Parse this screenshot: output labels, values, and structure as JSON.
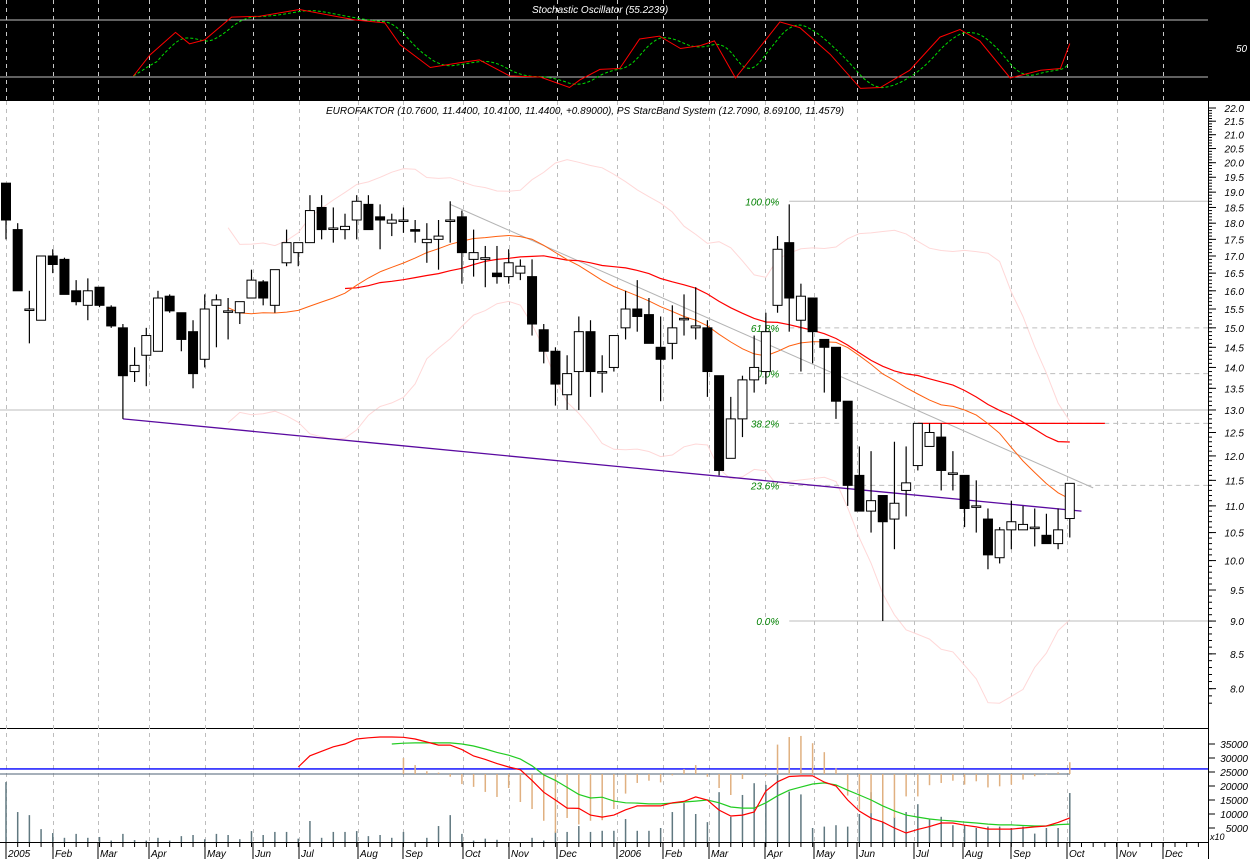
{
  "chart_data": [
    {
      "type": "candlestick",
      "name": "price",
      "title": "EUROFAKTOR (10.7600, 11.4400, 10.4100, 11.4400, +0.89000), PS StarcBand System  (12.7090, 8.69100, 11.4579)",
      "x_unit": "week index (weekly candles, Jan 2005 - Oct 2006)",
      "y_scale": "log",
      "ylim": [
        7.6,
        22.2
      ],
      "y_ticks": [
        "22.0",
        "21.5",
        "21.0",
        "20.5",
        "20.0",
        "19.5",
        "19.0",
        "18.5",
        "18.0",
        "17.5",
        "17.0",
        "16.5",
        "16.0",
        "15.5",
        "15.0",
        "14.5",
        "14.0",
        "13.5",
        "13.0",
        "12.5",
        "12.0",
        "11.5",
        "11.0",
        "10.5",
        "10.0",
        "9.5",
        "9.0",
        "8.5",
        "8.0"
      ],
      "ohlc": [
        [
          19.3,
          19.3,
          17.5,
          18.1
        ],
        [
          17.8,
          18.0,
          16.0,
          16.0
        ],
        [
          15.5,
          16.0,
          14.6,
          15.5
        ],
        [
          15.2,
          17.0,
          15.2,
          17.0
        ],
        [
          17.0,
          17.2,
          16.5,
          16.75
        ],
        [
          16.9,
          16.95,
          15.9,
          15.9
        ],
        [
          16.0,
          16.3,
          15.6,
          15.7
        ],
        [
          15.6,
          16.35,
          15.2,
          16.0
        ],
        [
          16.1,
          16.1,
          15.55,
          15.6
        ],
        [
          15.55,
          15.6,
          15.0,
          15.05
        ],
        [
          15.0,
          15.1,
          12.8,
          13.8
        ],
        [
          13.9,
          14.5,
          13.65,
          14.05
        ],
        [
          14.3,
          15.0,
          13.55,
          14.8
        ],
        [
          14.4,
          16.0,
          14.4,
          15.8
        ],
        [
          15.85,
          15.9,
          15.4,
          15.45
        ],
        [
          15.4,
          15.4,
          14.4,
          14.7
        ],
        [
          14.9,
          15.2,
          13.5,
          13.85
        ],
        [
          14.2,
          15.9,
          14.0,
          15.5
        ],
        [
          15.6,
          15.9,
          14.5,
          15.75
        ],
        [
          15.45,
          15.8,
          14.7,
          15.45
        ],
        [
          15.4,
          15.7,
          15.1,
          15.7
        ],
        [
          15.8,
          16.6,
          15.8,
          16.3
        ],
        [
          16.25,
          16.3,
          15.6,
          15.8
        ],
        [
          15.6,
          16.6,
          15.4,
          16.6
        ],
        [
          16.8,
          17.8,
          16.7,
          17.4
        ],
        [
          17.1,
          17.4,
          16.7,
          17.4
        ],
        [
          17.4,
          18.9,
          17.4,
          18.4
        ],
        [
          18.5,
          18.9,
          17.5,
          17.8
        ],
        [
          17.85,
          18.5,
          17.4,
          17.85
        ],
        [
          17.8,
          18.3,
          17.5,
          17.9
        ],
        [
          18.1,
          18.9,
          17.5,
          18.7
        ],
        [
          18.6,
          18.9,
          17.8,
          17.8
        ],
        [
          18.2,
          18.6,
          17.2,
          18.1
        ],
        [
          18.0,
          18.3,
          17.6,
          18.1
        ],
        [
          18.1,
          18.5,
          17.7,
          18.1
        ],
        [
          17.8,
          18.1,
          17.4,
          17.75
        ],
        [
          17.4,
          18.0,
          16.8,
          17.5
        ],
        [
          17.5,
          18.1,
          16.6,
          17.6
        ],
        [
          18.1,
          18.7,
          17.4,
          18.1
        ],
        [
          18.2,
          18.4,
          16.2,
          17.1
        ],
        [
          16.9,
          17.8,
          16.4,
          17.1
        ],
        [
          16.9,
          17.3,
          16.1,
          16.95
        ],
        [
          16.5,
          17.3,
          16.2,
          16.4
        ],
        [
          16.4,
          17.2,
          16.2,
          16.8
        ],
        [
          16.5,
          16.9,
          16.3,
          16.7
        ],
        [
          16.4,
          16.9,
          14.8,
          15.1
        ],
        [
          14.95,
          15.1,
          14.1,
          14.4
        ],
        [
          14.4,
          14.5,
          13.1,
          13.6
        ],
        [
          13.35,
          14.3,
          13.0,
          13.85
        ],
        [
          13.9,
          15.3,
          13.0,
          14.9
        ],
        [
          14.9,
          15.2,
          13.3,
          13.9
        ],
        [
          13.9,
          14.3,
          13.4,
          13.9
        ],
        [
          14.0,
          14.8,
          13.9,
          14.8
        ],
        [
          15.0,
          16.0,
          14.7,
          15.5
        ],
        [
          15.5,
          16.3,
          14.9,
          15.3
        ],
        [
          15.35,
          15.8,
          14.6,
          14.6
        ],
        [
          14.5,
          15.3,
          13.2,
          14.2
        ],
        [
          14.6,
          15.6,
          14.2,
          15.0
        ],
        [
          15.25,
          15.9,
          14.8,
          15.25
        ],
        [
          15.0,
          16.1,
          14.7,
          15.05
        ],
        [
          15.0,
          15.2,
          13.3,
          13.9
        ],
        [
          13.8,
          13.8,
          11.6,
          11.7
        ],
        [
          11.95,
          13.3,
          11.95,
          12.8
        ],
        [
          12.8,
          13.8,
          12.4,
          13.7
        ],
        [
          13.7,
          14.8,
          13.4,
          14.0
        ],
        [
          13.9,
          15.4,
          13.6,
          14.9
        ],
        [
          15.6,
          17.6,
          15.4,
          17.2
        ],
        [
          17.4,
          18.6,
          14.9,
          15.8
        ],
        [
          15.2,
          16.2,
          13.9,
          15.85
        ],
        [
          15.8,
          15.8,
          14.1,
          14.9
        ],
        [
          14.7,
          14.7,
          13.4,
          14.5
        ],
        [
          14.5,
          14.5,
          12.8,
          13.2
        ],
        [
          13.2,
          13.2,
          11.0,
          11.4
        ],
        [
          11.6,
          12.2,
          10.9,
          10.9
        ],
        [
          10.9,
          12.1,
          10.5,
          11.1
        ],
        [
          11.2,
          11.2,
          9.0,
          10.7
        ],
        [
          10.75,
          12.3,
          10.2,
          11.05
        ],
        [
          11.3,
          12.2,
          10.8,
          11.45
        ],
        [
          11.8,
          12.7,
          11.7,
          12.7
        ],
        [
          12.2,
          12.7,
          12.2,
          12.5
        ],
        [
          12.4,
          12.7,
          11.3,
          11.7
        ],
        [
          11.65,
          12.1,
          11.3,
          11.65
        ],
        [
          11.6,
          11.6,
          10.6,
          10.95
        ],
        [
          11.0,
          11.5,
          10.5,
          11.0
        ],
        [
          10.75,
          10.95,
          9.85,
          10.1
        ],
        [
          10.05,
          10.6,
          9.95,
          10.55
        ],
        [
          10.55,
          11.1,
          10.2,
          10.7
        ],
        [
          10.55,
          11.0,
          10.55,
          10.65
        ],
        [
          10.6,
          10.95,
          10.25,
          10.6
        ],
        [
          10.45,
          10.85,
          10.3,
          10.3
        ],
        [
          10.3,
          10.95,
          10.2,
          10.55
        ],
        [
          10.76,
          11.44,
          10.41,
          11.44
        ]
      ],
      "moving_averages": [
        {
          "name": "short MA",
          "period": 20,
          "color": "#ff6010"
        },
        {
          "name": "long MA",
          "period": 30,
          "color": "#ff0000"
        }
      ],
      "band_color": "#ffd8d8",
      "trendlines": [
        {
          "name": "support",
          "from": [
            10,
            12.8
          ],
          "to": [
            92,
            10.9
          ],
          "color": "#5a0aa0"
        },
        {
          "name": "resistance",
          "from": [
            38,
            18.6
          ],
          "to": [
            93,
            11.35
          ],
          "color": "#b4b4b4"
        }
      ],
      "horizontal_lines": [
        {
          "value": 13.0,
          "from": 0,
          "color": "#bdbdbd"
        },
        {
          "value": 12.7,
          "from": 78,
          "to": 94,
          "color": "#ff0000"
        }
      ],
      "fibonacci": {
        "from_week": 67,
        "high": 18.7,
        "low": 9.0,
        "color": "#008000",
        "levels": [
          {
            "label": "100.0%",
            "value": 18.7
          },
          {
            "label": "61.8%",
            "value": 15.0
          },
          {
            "label": "50.0%",
            "value": 13.85
          },
          {
            "label": "38.2%",
            "value": 12.7
          },
          {
            "label": "23.6%",
            "value": 11.4
          },
          {
            "label": "0.0%",
            "value": 9.0
          }
        ]
      }
    },
    {
      "type": "line",
      "name": "stochastic",
      "title": "Stochastic Oscillator (55.2239)",
      "ylim": [
        0,
        100
      ],
      "levels": [
        80,
        20
      ],
      "y_tick": "50",
      "k_points": [
        [
          10.9,
          21
        ],
        [
          12.3,
          43
        ],
        [
          14.5,
          67
        ],
        [
          15.7,
          55
        ],
        [
          17,
          59
        ],
        [
          19.3,
          83
        ],
        [
          21.7,
          84
        ],
        [
          25.1,
          91
        ],
        [
          27.7,
          85
        ],
        [
          29.9,
          80
        ],
        [
          32.4,
          77
        ],
        [
          33.7,
          54
        ],
        [
          36.3,
          30
        ],
        [
          38.8,
          35
        ],
        [
          40.5,
          38
        ],
        [
          43.1,
          21
        ],
        [
          45.7,
          20
        ],
        [
          48.2,
          9
        ],
        [
          49.1,
          17
        ],
        [
          50.8,
          28
        ],
        [
          52.5,
          29
        ],
        [
          54.2,
          60
        ],
        [
          55.9,
          63
        ],
        [
          57.7,
          50
        ],
        [
          59.4,
          53
        ],
        [
          60.6,
          58
        ],
        [
          62.4,
          19
        ],
        [
          66.2,
          78
        ],
        [
          67.9,
          72
        ],
        [
          70.5,
          44
        ],
        [
          73.1,
          8
        ],
        [
          74.8,
          9
        ],
        [
          77.3,
          27
        ],
        [
          79.9,
          62
        ],
        [
          81.6,
          70
        ],
        [
          83.3,
          58
        ],
        [
          85.9,
          19
        ],
        [
          88.5,
          27
        ],
        [
          90.2,
          29
        ],
        [
          91,
          55.2
        ]
      ],
      "k_color": "#ff0000",
      "d_color": "#00dd00"
    },
    {
      "type": "bar",
      "name": "volume",
      "multiplier_label": "x10",
      "y_ticks": [
        "35000",
        "30000",
        "25000",
        "20000",
        "15000",
        "10000",
        "5000"
      ],
      "ylim": [
        0,
        40000
      ],
      "volume_thousands": [
        21.4,
        10.7,
        9.6,
        4.6,
        3.2,
        1.5,
        2.9,
        1.5,
        1.8,
        0.5,
        2.9,
        0.7,
        0.5,
        1.5,
        0.5,
        2.1,
        2.5,
        1,
        2.9,
        2.5,
        1,
        3.9,
        2.5,
        3.6,
        3.6,
        1.2,
        7.5,
        1.5,
        3.6,
        3.6,
        3.9,
        2.1,
        2.5,
        1.5,
        3.6,
        0,
        1.5,
        5.7,
        9.6,
        2.9,
        0.5,
        1.2,
        0.8,
        0,
        0,
        1.5,
        0.5,
        3.8,
        3.6,
        5.7,
        3.6,
        4,
        4,
        8.2,
        4,
        4,
        5,
        10.7,
        13.9,
        10,
        7.1,
        17.8,
        9,
        16.8,
        21,
        20.4,
        23.9,
        18,
        17,
        5,
        5.5,
        6,
        5.5,
        10,
        17.8,
        8,
        9,
        10.7,
        13.5,
        8,
        9,
        6,
        6,
        5,
        5.5,
        5.5,
        5,
        5.5,
        3,
        5,
        5,
        17.5
      ],
      "oscillator_start": 34,
      "oscillator_thousands": [
        5.7,
        3.2,
        1,
        0.5,
        -1,
        -3.6,
        -4.6,
        -6.4,
        -8.2,
        -5,
        -10,
        -12.5,
        -16.7,
        -21,
        -15.7,
        -18,
        -16.7,
        -16.5,
        -12.5,
        -7,
        -3.2,
        -2.4,
        -3,
        -0.5,
        1.8,
        3.2,
        -1,
        -5,
        -7.5,
        -1.8,
        0,
        -0.5,
        10.5,
        13.2,
        13.6,
        11,
        7.8,
        2,
        -7.7,
        -12.7,
        -14,
        -17,
        -15.7,
        -8,
        -8,
        -4,
        -3.2,
        -2.4,
        -3.8,
        -2.6,
        -4.8,
        -4.4,
        -3.8,
        -2,
        -0.8,
        -0.2,
        0.6,
        4.2
      ],
      "red_start": 25,
      "red_line": [
        26.8,
        30.8,
        32.4,
        34.0,
        35.0,
        36.8,
        37.2,
        37.5,
        37.5,
        37.4,
        36.8,
        35.7,
        34.6,
        34.6,
        33.0,
        30.7,
        29.5,
        28.0,
        26.8,
        25.8,
        22.0,
        17.8,
        15.0,
        12.1,
        12.0,
        9.6,
        8.9,
        9.6,
        11.5,
        12.9,
        12.9,
        12.9,
        14.0,
        14.5,
        16.1,
        15.0,
        11.4,
        9.3,
        9.6,
        10.7,
        18.2,
        21.5,
        23.4,
        23.6,
        23.6,
        21.4,
        20.0,
        15.0,
        11.0,
        8.5,
        7.1,
        5.0,
        3.2,
        4.5,
        5.5,
        6.8,
        6.8,
        6.0,
        5.4,
        4.6,
        4.6,
        4.6,
        5.0,
        5.4,
        5.7,
        7.0,
        8.6
      ],
      "green_start": 33,
      "green_line": [
        35.0,
        35.3,
        35.4,
        35.4,
        35.4,
        35.4,
        35.0,
        34.3,
        33.2,
        32.0,
        31.0,
        29.6,
        27.2,
        24.0,
        22.0,
        19.5,
        17.0,
        15.7,
        16.0,
        14.6,
        14.0,
        13.9,
        13.6,
        13.6,
        13.9,
        14.3,
        14.6,
        15.0,
        14.0,
        12.5,
        12.1,
        12.1,
        14.0,
        16.5,
        18.5,
        19.6,
        20.7,
        21.1,
        20.4,
        18.5,
        16.8,
        15.0,
        12.9,
        11.1,
        9.6,
        8.9,
        8.2,
        7.8,
        7.5,
        7.1,
        6.8,
        6.4,
        6.1,
        6.1,
        5.9,
        5.7,
        5.7,
        6.2,
        6.4
      ],
      "reference_level": 26.1,
      "colors": {
        "volume": "#607880",
        "oscillator": "#e0b080",
        "reference": "#0000ff",
        "red": "#ff0000",
        "green": "#22cc22"
      }
    }
  ],
  "x_axis": {
    "months": [
      {
        "label": "2005",
        "week": 0
      },
      {
        "label": "Feb",
        "week": 4
      },
      {
        "label": "Mar",
        "week": 7.9
      },
      {
        "label": "Apr",
        "week": 12.2
      },
      {
        "label": "May",
        "week": 17
      },
      {
        "label": "Jun",
        "week": 21.1
      },
      {
        "label": "Jul",
        "week": 25.1
      },
      {
        "label": "Aug",
        "week": 30.1
      },
      {
        "label": "Sep",
        "week": 34
      },
      {
        "label": "Oct",
        "week": 39.1
      },
      {
        "label": "Nov",
        "week": 43
      },
      {
        "label": "Dec",
        "week": 47.1
      },
      {
        "label": "2006",
        "week": 52.3
      },
      {
        "label": "Feb",
        "week": 56.2
      },
      {
        "label": "Mar",
        "week": 60.1
      },
      {
        "label": "Apr",
        "week": 64.9
      },
      {
        "label": "May",
        "week": 69.1
      },
      {
        "label": "Jun",
        "week": 72.8
      },
      {
        "label": "Jul",
        "week": 77.7
      },
      {
        "label": "Aug",
        "week": 81.9
      },
      {
        "label": "Sep",
        "week": 86
      },
      {
        "label": "Oct",
        "week": 90.8
      },
      {
        "label": "Nov",
        "week": 95
      },
      {
        "label": "Dec",
        "week": 99
      }
    ]
  }
}
